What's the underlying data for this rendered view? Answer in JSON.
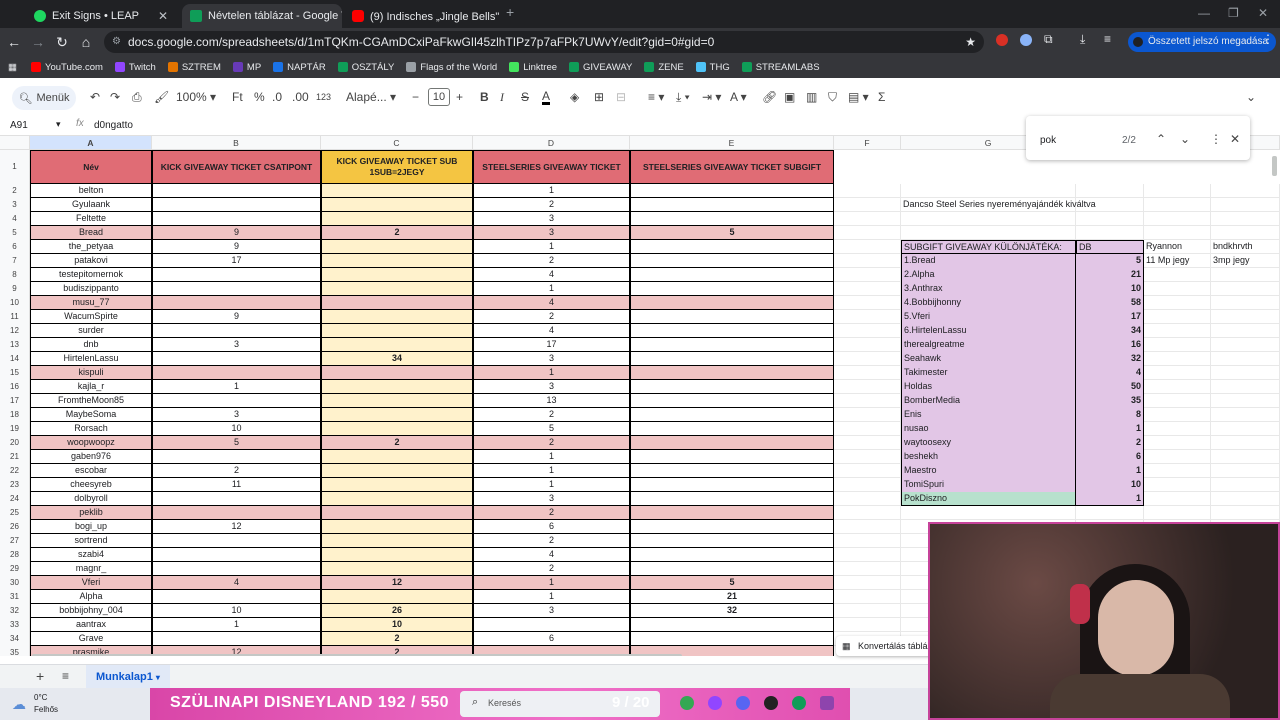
{
  "browser": {
    "tabs": [
      {
        "title": "Exit Signs • LEAP",
        "color": "#1ed760",
        "active": false
      },
      {
        "title": "Névtelen táblázat - Google Tábl",
        "color": "#0f9d58",
        "active": true
      },
      {
        "title": "(9) Indisches „Jingle Bells\" 😂",
        "color": "#ff0000",
        "active": false
      }
    ],
    "url": "docs.google.com/spreadsheets/d/1mTQKm-CGAmDCxiPaFkwGIl45zlhTIPz7p7aFPk7UWvY/edit?gid=0#gid=0",
    "password_button": "Összetett jelszó megadása",
    "bookmarks": [
      {
        "label": "YouTube.com",
        "color": "#ff0000"
      },
      {
        "label": "Twitch",
        "color": "#9146ff"
      },
      {
        "label": "SZTREM",
        "color": "#e37400"
      },
      {
        "label": "MP",
        "color": "#673ab7"
      },
      {
        "label": "NAPTÁR",
        "color": "#1a73e8"
      },
      {
        "label": "OSZTÁLY",
        "color": "#0f9d58"
      },
      {
        "label": "Flags of the World",
        "color": "#9aa0a6"
      },
      {
        "label": "Linktree",
        "color": "#43e55e"
      },
      {
        "label": "GIVEAWAY",
        "color": "#0f9d58"
      },
      {
        "label": "ZENE",
        "color": "#0f9d58"
      },
      {
        "label": "THG",
        "color": "#4fc3f7"
      },
      {
        "label": "STREAMLABS",
        "color": "#0f9d58"
      }
    ]
  },
  "toolbar": {
    "menu_label": "Menük",
    "zoom": "100%",
    "format_ft": "Ft",
    "format_pct": "%",
    "format_dec_down": ".0",
    "format_dec_up": ".00",
    "format_123": "123",
    "font_name": "Alapé...",
    "font_size": "10"
  },
  "formula_bar": {
    "cell_ref": "A91",
    "content": "d0ngatto"
  },
  "find": {
    "query": "pok",
    "count": "2/2"
  },
  "columns": [
    "A",
    "B",
    "C",
    "D",
    "E",
    "F",
    "G"
  ],
  "headers": {
    "A": "Név",
    "B": "KICK GIVEAWAY TICKET CSATIPONT",
    "C": "KICK GIVEAWAY TICKET SUB 1SUB=2JEGY",
    "D": "STEELSERIES GIVEAWAY TICKET",
    "E": "STEELSERIES GIVEAWAY TICKET SUBGIFT"
  },
  "rows": [
    {
      "n": "2",
      "a": "belton",
      "b": "",
      "c": "",
      "d": "1",
      "e": "",
      "hl": false
    },
    {
      "n": "3",
      "a": "Gyulaank",
      "b": "",
      "c": "",
      "d": "2",
      "e": "",
      "hl": false
    },
    {
      "n": "4",
      "a": "Feltette",
      "b": "",
      "c": "",
      "d": "3",
      "e": "",
      "hl": false
    },
    {
      "n": "5",
      "a": "Bread",
      "b": "9",
      "c": "2",
      "d": "3",
      "e": "5",
      "hl": true
    },
    {
      "n": "6",
      "a": "the_petyaa",
      "b": "9",
      "c": "",
      "d": "1",
      "e": "",
      "hl": false
    },
    {
      "n": "7",
      "a": "patakovi",
      "b": "17",
      "c": "",
      "d": "2",
      "e": "",
      "hl": false
    },
    {
      "n": "8",
      "a": "testepitomernok",
      "b": "",
      "c": "",
      "d": "4",
      "e": "",
      "hl": false
    },
    {
      "n": "9",
      "a": "budiszippanto",
      "b": "",
      "c": "",
      "d": "1",
      "e": "",
      "hl": false
    },
    {
      "n": "10",
      "a": "musu_77",
      "b": "",
      "c": "",
      "d": "4",
      "e": "",
      "hl": true
    },
    {
      "n": "11",
      "a": "WacumSpirte",
      "b": "9",
      "c": "",
      "d": "2",
      "e": "",
      "hl": false
    },
    {
      "n": "12",
      "a": "surder",
      "b": "",
      "c": "",
      "d": "4",
      "e": "",
      "hl": false
    },
    {
      "n": "13",
      "a": "dnb",
      "b": "3",
      "c": "",
      "d": "17",
      "e": "",
      "hl": false
    },
    {
      "n": "14",
      "a": "HirtelenLassu",
      "b": "",
      "c": "34",
      "d": "3",
      "e": "",
      "hl": false
    },
    {
      "n": "15",
      "a": "kispuli",
      "b": "",
      "c": "",
      "d": "1",
      "e": "",
      "hl": true
    },
    {
      "n": "16",
      "a": "kajla_r",
      "b": "1",
      "c": "",
      "d": "3",
      "e": "",
      "hl": false
    },
    {
      "n": "17",
      "a": "FromtheMoon85",
      "b": "",
      "c": "",
      "d": "13",
      "e": "",
      "hl": false
    },
    {
      "n": "18",
      "a": "MaybeSoma",
      "b": "3",
      "c": "",
      "d": "2",
      "e": "",
      "hl": false
    },
    {
      "n": "19",
      "a": "Rorsach",
      "b": "10",
      "c": "",
      "d": "5",
      "e": "",
      "hl": false
    },
    {
      "n": "20",
      "a": "woopwoopz",
      "b": "5",
      "c": "2",
      "d": "2",
      "e": "",
      "hl": true
    },
    {
      "n": "21",
      "a": "gaben976",
      "b": "",
      "c": "",
      "d": "1",
      "e": "",
      "hl": false
    },
    {
      "n": "22",
      "a": "escobar",
      "b": "2",
      "c": "",
      "d": "1",
      "e": "",
      "hl": false
    },
    {
      "n": "23",
      "a": "cheesyreb",
      "b": "11",
      "c": "",
      "d": "1",
      "e": "",
      "hl": false
    },
    {
      "n": "24",
      "a": "dolbyroll",
      "b": "",
      "c": "",
      "d": "3",
      "e": "",
      "hl": false
    },
    {
      "n": "25",
      "a": "peklib",
      "b": "",
      "c": "",
      "d": "2",
      "e": "",
      "hl": true
    },
    {
      "n": "26",
      "a": "bogi_up",
      "b": "12",
      "c": "",
      "d": "6",
      "e": "",
      "hl": false
    },
    {
      "n": "27",
      "a": "sortrend",
      "b": "",
      "c": "",
      "d": "2",
      "e": "",
      "hl": false
    },
    {
      "n": "28",
      "a": "szabi4",
      "b": "",
      "c": "",
      "d": "4",
      "e": "",
      "hl": false
    },
    {
      "n": "29",
      "a": "magnr_",
      "b": "",
      "c": "",
      "d": "2",
      "e": "",
      "hl": false
    },
    {
      "n": "30",
      "a": "Vferi",
      "b": "4",
      "c": "12",
      "d": "1",
      "e": "5",
      "hl": true
    },
    {
      "n": "31",
      "a": "Alpha",
      "b": "",
      "c": "",
      "d": "1",
      "e": "21",
      "hl": false
    },
    {
      "n": "32",
      "a": "bobbijohny_004",
      "b": "10",
      "c": "26",
      "d": "3",
      "e": "32",
      "hl": false
    },
    {
      "n": "33",
      "a": "aantrax",
      "b": "1",
      "c": "10",
      "d": "",
      "e": "",
      "hl": false
    },
    {
      "n": "34",
      "a": "Grave",
      "b": "",
      "c": "2",
      "d": "6",
      "e": "",
      "hl": false
    },
    {
      "n": "35",
      "a": "prasmike",
      "b": "12",
      "c": "2",
      "d": "",
      "e": "",
      "hl": true
    }
  ],
  "side": {
    "note": "Dancso Steel Series nyereményajándék kiváltva",
    "table_header": "SUBGIFT GIVEAWAY KÜLÖNJÁTÉKA:",
    "table_db": "DB",
    "extra1_name": "Ryannon",
    "extra1_val": "11 Mp jegy",
    "extra2_name": "bndkhrvth",
    "extra2_val": "3mp jegy",
    "entries": [
      {
        "name": "1.Bread",
        "val": "5"
      },
      {
        "name": "2.Alpha",
        "val": "21"
      },
      {
        "name": "3.Anthrax",
        "val": "10"
      },
      {
        "name": "4.Bobbijhonny",
        "val": "58"
      },
      {
        "name": "5.Vferi",
        "val": "17"
      },
      {
        "name": "6.HirtelenLassu",
        "val": "34"
      },
      {
        "name": "therealgreatme",
        "val": "16"
      },
      {
        "name": "Seahawk",
        "val": "32"
      },
      {
        "name": "Takimester",
        "val": "4"
      },
      {
        "name": "Holdas",
        "val": "50"
      },
      {
        "name": "BomberMedia",
        "val": "35"
      },
      {
        "name": "Enis",
        "val": "8"
      },
      {
        "name": "nusao",
        "val": "1"
      },
      {
        "name": "waytoosexy",
        "val": "2"
      },
      {
        "name": "beshekh",
        "val": "6"
      },
      {
        "name": "Maestro",
        "val": "1"
      },
      {
        "name": "TomiSpuri",
        "val": "10"
      },
      {
        "name": "PokDiszno",
        "val": "1"
      }
    ]
  },
  "sheet_tab": "Munkalap1",
  "convert_label": "Konvertálás tábláz",
  "taskbar": {
    "weather_temp": "0°C",
    "weather_desc": "Felhős",
    "banner_text": "SZÜLINAPI DISNEYLAND  192 / 550",
    "search_placeholder": "Keresés",
    "counter": "9 / 20"
  },
  "colors": {
    "header_red": "#e06c75",
    "header_yellow": "#f4c542",
    "row_pink": "#f0c4c4",
    "col_c_yellow": "#fff2cc",
    "side_purple": "#e2c6e6",
    "side_green": "#b7e1cd"
  }
}
